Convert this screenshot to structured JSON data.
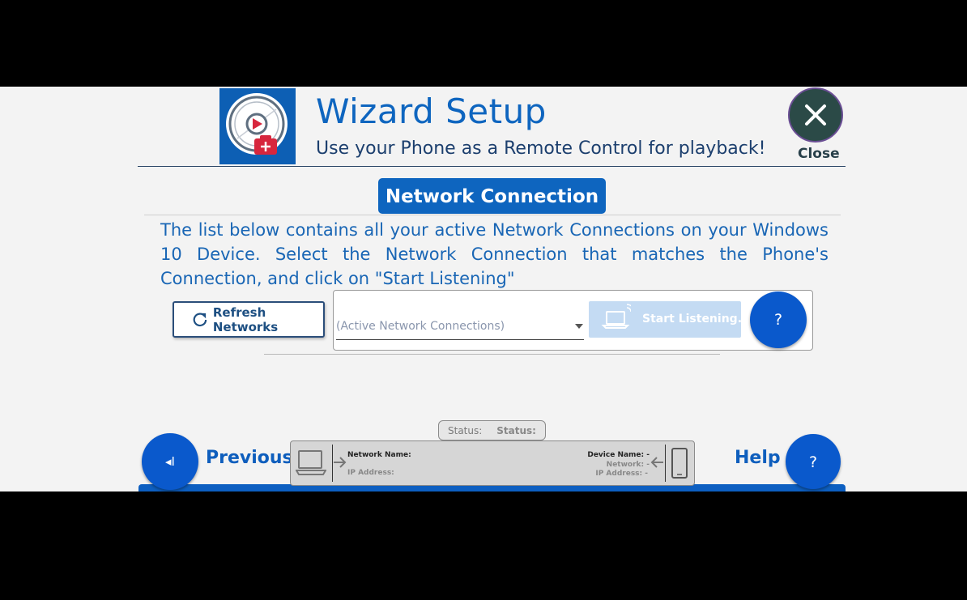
{
  "header": {
    "title": "Wizard Setup",
    "subtitle": "Use your Phone as a Remote Control for playback!",
    "logo_icon": "media-remote-logo",
    "close_icon": "close-icon",
    "close_label": "Close"
  },
  "section": {
    "title": "Network Connection",
    "description": "The list below contains all your active Network Connections on your Windows 10 Device. Select the Network Connection that matches the Phone's Connection, and click on \"Start Listening\""
  },
  "controls": {
    "refresh_icon": "refresh-icon",
    "refresh_label": "Refresh Networks",
    "dropdown_placeholder": "(Active Network Connections)",
    "listen_icon": "laptop-wireless-icon",
    "listen_label": "Start Listening..",
    "help_glyph": "?"
  },
  "status": {
    "label": "Status:",
    "value": "Status:"
  },
  "connection_info": {
    "network_name_label": "Network Name:",
    "ip_address_label": "IP Address:",
    "device_name_label": "Device Name: -",
    "network_label": "Network: -",
    "device_ip_label": "IP Address: -"
  },
  "footer": {
    "previous_label": "Previous",
    "previous_glyph": "◂I",
    "help_label": "Help",
    "help_glyph": "?"
  },
  "colors": {
    "primary": "#0e65bf",
    "dark_header": "#1c3f6e",
    "close_bg": "#2b4a47",
    "disabled_button": "#c4dbf3",
    "app_bg": "#f3f3f3"
  }
}
